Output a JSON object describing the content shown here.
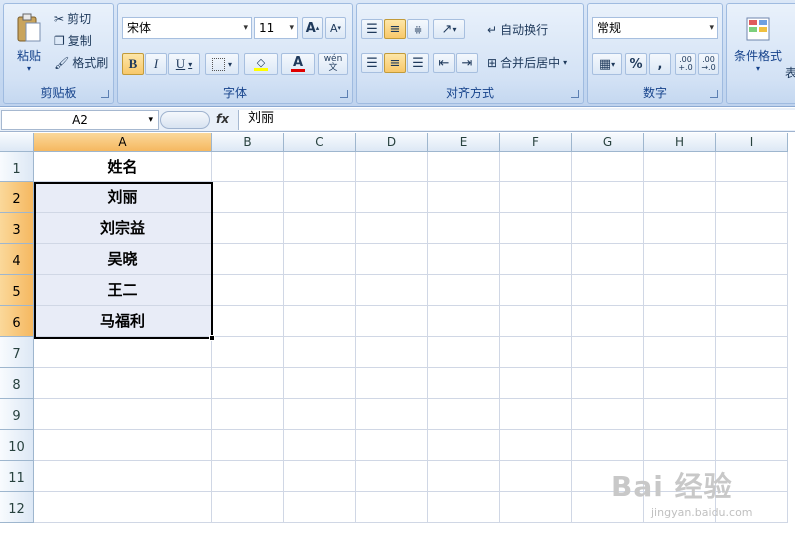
{
  "ribbon": {
    "clipboard": {
      "paste": "粘贴",
      "cut": "剪切",
      "copy": "复制",
      "format_painter": "格式刷",
      "group": "剪贴板"
    },
    "font": {
      "name": "宋体",
      "size": "11",
      "grow": "A",
      "shrink": "A",
      "bold": "B",
      "italic": "I",
      "underline": "U",
      "phonetic": "wén\n文",
      "group": "字体"
    },
    "alignment": {
      "wrap": "自动换行",
      "merge": "合并后居中",
      "group": "对齐方式"
    },
    "number": {
      "format": "常规",
      "percent": "%",
      "comma": ",",
      "inc_decimal": ".00 +.0",
      "dec_decimal": ".00 →.0",
      "group": "数字"
    },
    "styles": {
      "conditional": "条件格式",
      "table": "表"
    }
  },
  "formula_bar": {
    "name_box": "A2",
    "fx": "fx",
    "content": "刘丽"
  },
  "columns": [
    "A",
    "B",
    "C",
    "D",
    "E",
    "F",
    "G",
    "H",
    "I"
  ],
  "rows": [
    "1",
    "2",
    "3",
    "4",
    "5",
    "6",
    "7",
    "8",
    "9",
    "10",
    "11",
    "12"
  ],
  "cells": {
    "A1": "姓名",
    "A2": "刘丽",
    "A3": "刘宗益",
    "A4": "吴晓",
    "A5": "王二",
    "A6": "马福利"
  },
  "watermark": {
    "brand": "Bai 经验",
    "url": "jingyan.baidu.com"
  },
  "colors": {
    "selection_header": "#f5b860",
    "selected_fill": "#e8ecf7",
    "ribbon": "#dbe7f7"
  }
}
